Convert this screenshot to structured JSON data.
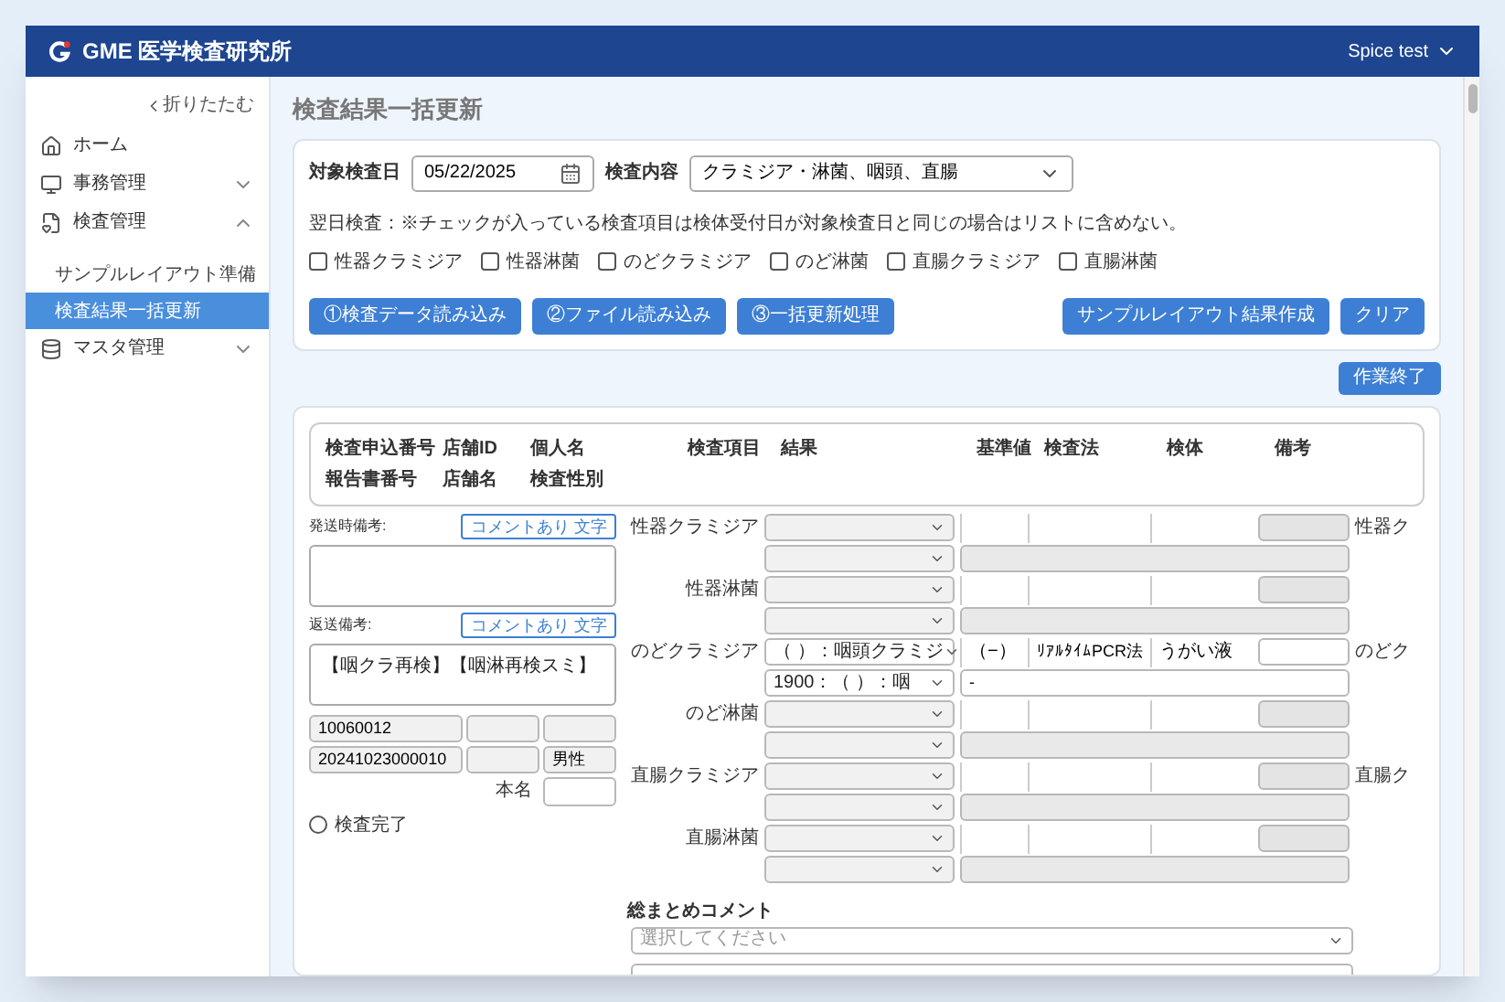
{
  "header": {
    "logo_text": "GME 医学検査研究所",
    "user": "Spice test"
  },
  "sidebar": {
    "collapse": "折りたたむ",
    "items": [
      {
        "label": "ホーム",
        "kind": "link",
        "selected": false
      },
      {
        "label": "事務管理",
        "kind": "group",
        "expanded": false
      },
      {
        "label": "検査管理",
        "kind": "group",
        "expanded": true,
        "children": [
          {
            "label": "サンプルレイアウト準備",
            "selected": false
          },
          {
            "label": "検査結果一括更新",
            "selected": true
          }
        ]
      },
      {
        "label": "マスタ管理",
        "kind": "group",
        "expanded": false
      }
    ]
  },
  "page_title": "検査結果一括更新",
  "filter": {
    "date_label": "対象検査日",
    "date_value": "05/22/2025",
    "content_label": "検査内容",
    "content_value": "クラミジア・淋菌、咽頭、直腸",
    "note": "翌日検査：※チェックが入っている検査項目は検体受付日が対象検査日と同じの場合はリストに含めない。",
    "checkboxes": [
      {
        "label": "性器クラミジア",
        "checked": false
      },
      {
        "label": "性器淋菌",
        "checked": false
      },
      {
        "label": "のどクラミジア",
        "checked": false
      },
      {
        "label": "のど淋菌",
        "checked": false
      },
      {
        "label": "直腸クラミジア",
        "checked": false
      },
      {
        "label": "直腸淋菌",
        "checked": false
      }
    ],
    "buttons_left": [
      "①検査データ読み込み",
      "②ファイル読み込み",
      "③一括更新処理"
    ],
    "buttons_right": [
      "サンプルレイアウト結果作成",
      "クリア"
    ]
  },
  "finish_button": "作業終了",
  "results": {
    "columns_left": [
      {
        "top": "検査申込番号",
        "bottom": "報告書番号"
      },
      {
        "top": "店舗ID",
        "bottom": "店舗名"
      },
      {
        "top": "個人名",
        "bottom": "検査性別"
      }
    ],
    "columns_right": [
      "検査項目",
      "結果",
      "基準値",
      "検査法",
      "検体",
      "備考"
    ],
    "shipping_note": {
      "label": "発送時備考:",
      "tag": "コメントあり 文字"
    },
    "return_note": {
      "label": "返送備考:",
      "tag": "コメントあり 文字",
      "value": "【咽クラ再検】【咽淋再検スミ】"
    },
    "id_rows": [
      {
        "col_1": "10060012"
      },
      {
        "col_1": "20241023000010",
        "col_3": "男性"
      }
    ],
    "name_label": "本名",
    "complete": {
      "label": "検査完了",
      "checked": false
    },
    "tests": [
      {
        "name": "性器クラミジア",
        "remark_disabled": true,
        "comment_disabled": true,
        "side_label": "性器ク"
      },
      {
        "name": "性器淋菌",
        "remark_disabled": true,
        "comment_disabled": true
      },
      {
        "name": "のどクラミジア",
        "result": "（ ）：咽頭クラミジ",
        "reference": "（−）",
        "method": "ﾘｱﾙﾀｲﾑPCR法",
        "specimen": "うがい液",
        "sub_result": "1900：（ ）：咽",
        "comment": "-",
        "remark_disabled": false,
        "comment_disabled": false,
        "side_label": "のどク"
      },
      {
        "name": "のど淋菌",
        "remark_disabled": true,
        "comment_disabled": true
      },
      {
        "name": "直腸クラミジア",
        "remark_disabled": true,
        "comment_disabled": true,
        "side_label": "直腸ク"
      },
      {
        "name": "直腸淋菌",
        "remark_disabled": true,
        "comment_disabled": true
      }
    ],
    "summary": {
      "label": "総まとめコメント",
      "placeholder": "選択してください"
    }
  }
}
